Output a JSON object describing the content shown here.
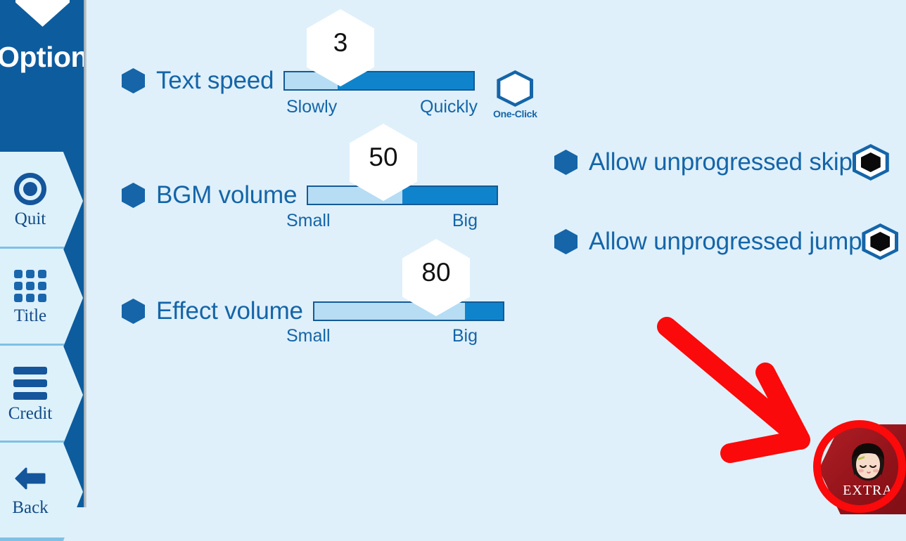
{
  "window": {
    "background_color": "#dff0fa",
    "sidebar_color": "#0d5c9e",
    "accent_color": "#1565a8"
  },
  "sidebar": {
    "title": "Option",
    "items": [
      {
        "label": "Quit",
        "icon": "power-icon"
      },
      {
        "label": "Title",
        "icon": "grid-icon"
      },
      {
        "label": "Credit",
        "icon": "hamburger-icon"
      },
      {
        "label": "Back",
        "icon": "arrow-left-icon"
      }
    ]
  },
  "main": {
    "sliders": [
      {
        "label": "Text speed",
        "value": "3",
        "percent": 28,
        "min_label": "Slowly",
        "max_label": "Quickly"
      },
      {
        "label": "BGM volume",
        "value": "50",
        "percent": 50,
        "min_label": "Small",
        "max_label": "Big"
      },
      {
        "label": "Effect volume",
        "value": "80",
        "percent": 80,
        "min_label": "Small",
        "max_label": "Big"
      }
    ],
    "one_click": {
      "label": "One-Click",
      "checked": false
    },
    "toggles": [
      {
        "label": "Allow unprogressed skip",
        "checked": true
      },
      {
        "label": "Allow unprogressed jump",
        "checked": true
      }
    ]
  },
  "extra_button": {
    "label": "EXTRA",
    "color": "#8f1219"
  },
  "annotations": {
    "arrow_color": "#fa0a0a",
    "circle_color": "#fa0a0a"
  }
}
